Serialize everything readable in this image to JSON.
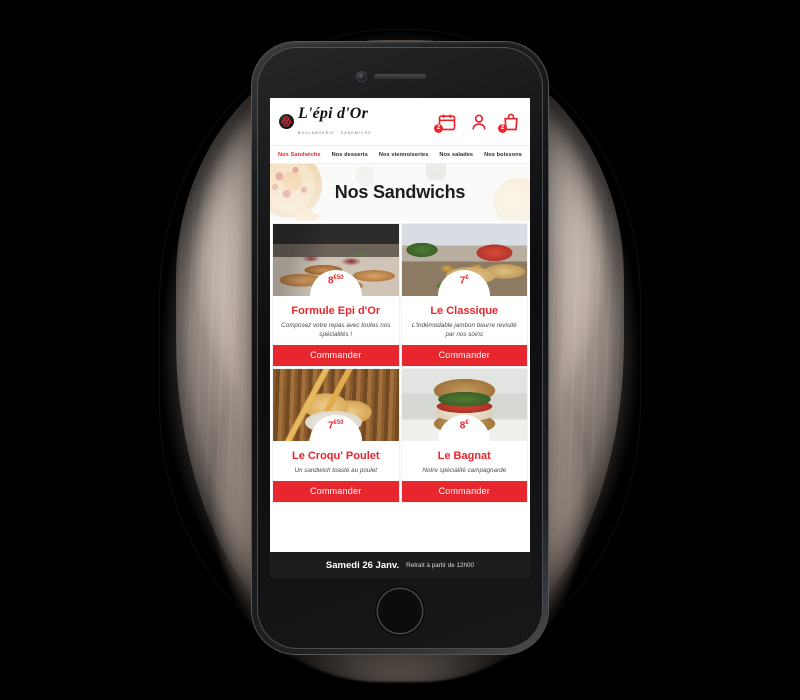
{
  "app": {
    "logo_name": "L'épi d'Or",
    "logo_tagline": "BOULANGERIE · SANDWICHS"
  },
  "header": {
    "icons": [
      {
        "name": "calendar-icon",
        "badge": "2"
      },
      {
        "name": "account-icon",
        "badge": ""
      },
      {
        "name": "shopping-bag-icon",
        "badge": "2"
      }
    ]
  },
  "nav": {
    "items": [
      {
        "label": "Nos Sandwichs",
        "active": true
      },
      {
        "label": "Nos desserts",
        "active": false
      },
      {
        "label": "Nos viennoiseries",
        "active": false
      },
      {
        "label": "Nos salades",
        "active": false
      },
      {
        "label": "Nos boissons",
        "active": false
      }
    ]
  },
  "hero": {
    "title": "Nos Sandwichs"
  },
  "products": [
    {
      "title": "Formule Epi d'Or",
      "price_main": "8",
      "price_sup": "€50",
      "description": "Composez votre repas avec toutes nos spécialités !",
      "button_label": "Commander",
      "image": "baguette-sandwiches-photo"
    },
    {
      "title": "Le Classique",
      "price_main": "7",
      "price_sup": "€",
      "description": "L'indémodable jambon beurre revisité par nos soins",
      "button_label": "Commander",
      "image": "baguette-salad-sandwich-photo"
    },
    {
      "title": "Le Croqu' Poulet",
      "price_main": "7",
      "price_sup": "€50",
      "description": "Un sandwich toasté au poulet",
      "button_label": "Commander",
      "image": "toasted-panini-photo"
    },
    {
      "title": "Le Bagnat",
      "price_main": "8",
      "price_sup": "€",
      "description": "Notre spécialité campagnarde",
      "button_label": "Commander",
      "image": "round-bagnat-sandwich-photo"
    }
  ],
  "bottom_bar": {
    "date": "Samedi 26 Janv.",
    "note": "Retrait à partir de 12h00"
  },
  "colors": {
    "brand_red": "#e8262d",
    "dark_bar": "#1d1d1d",
    "page_background": "#000000",
    "brush_beige": "#e4d0c3"
  }
}
